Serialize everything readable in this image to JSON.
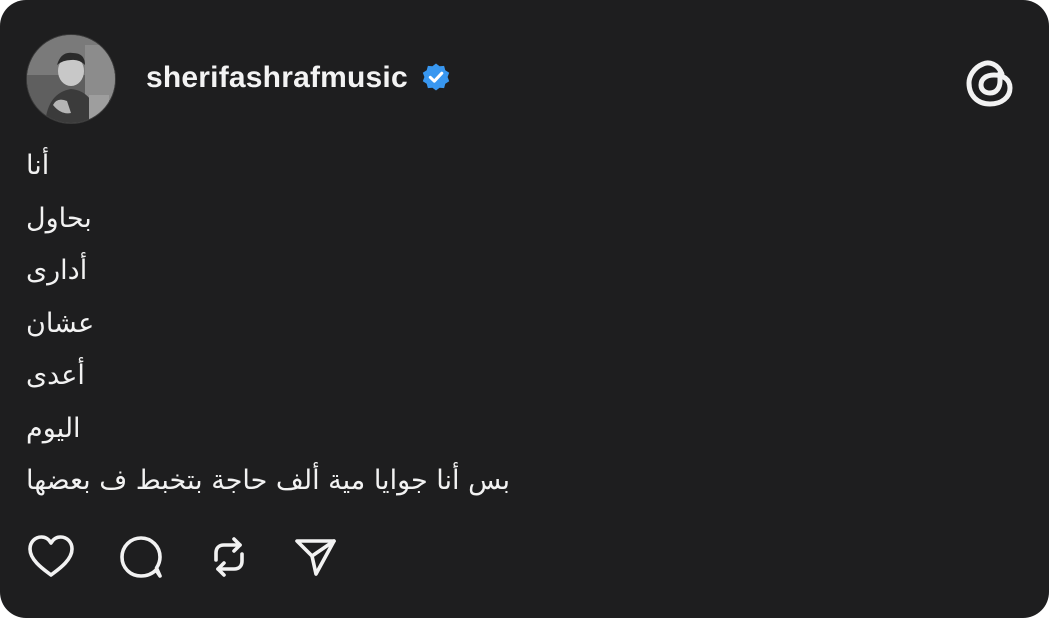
{
  "post": {
    "author": {
      "username": "sherifashrafmusic",
      "verified": true,
      "avatar_icon": "profile-photo"
    },
    "app_logo_icon": "threads-logo-icon",
    "lines": [
      "أنا",
      "بحاول",
      "أدارى",
      "عشان",
      "أعدى",
      "اليوم",
      "بس أنا جوايا مية ألف حاجة بتخبط ف بعضها"
    ],
    "actions": [
      {
        "icon": "heart-icon"
      },
      {
        "icon": "comment-icon"
      },
      {
        "icon": "repost-icon"
      },
      {
        "icon": "share-icon"
      }
    ]
  },
  "colors": {
    "background": "#1e1e1f",
    "text": "#f2f2f2",
    "verified_badge": "#3897f0"
  }
}
